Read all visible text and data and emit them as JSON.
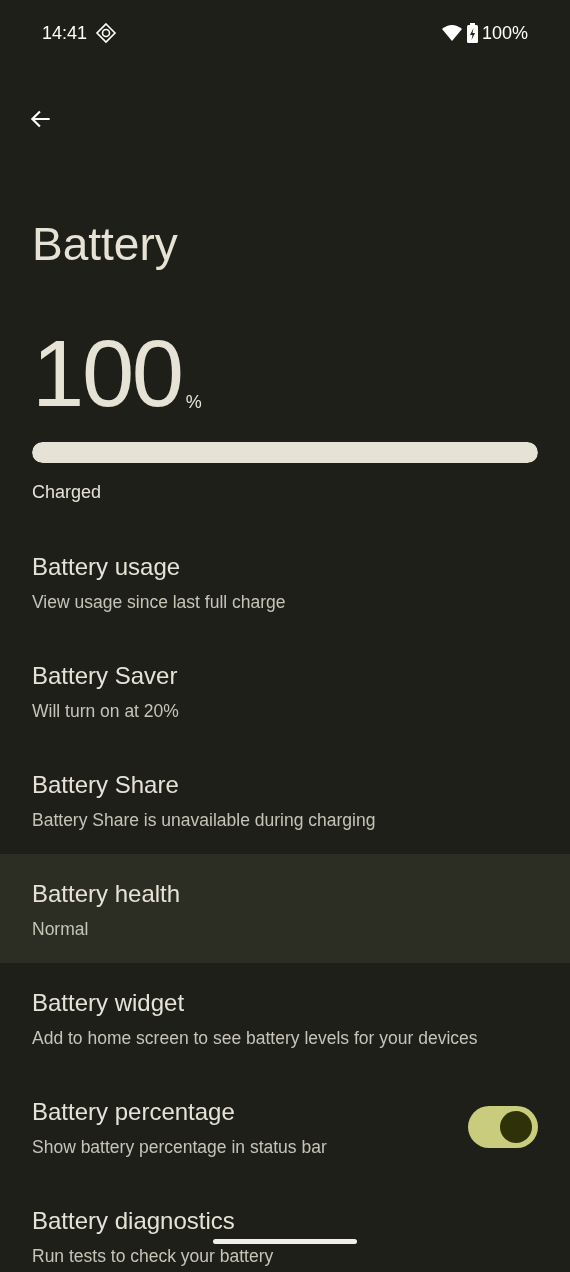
{
  "status_bar": {
    "time": "14:41",
    "battery": "100%"
  },
  "title": "Battery",
  "level_display": {
    "value": "100",
    "unit": "%",
    "level": 1.0,
    "status": "Charged"
  },
  "items": [
    {
      "kind": "link",
      "title": "Battery usage",
      "subtitle": "View usage since last full charge",
      "selected": false
    },
    {
      "kind": "link",
      "title": "Battery Saver",
      "subtitle": "Will turn on at 20%",
      "selected": false
    },
    {
      "kind": "link",
      "title": "Battery Share",
      "subtitle": "Battery Share is unavailable during charging",
      "selected": false
    },
    {
      "kind": "link",
      "title": "Battery health",
      "subtitle": "Normal",
      "selected": true
    },
    {
      "kind": "link",
      "title": "Battery widget",
      "subtitle": "Add to home screen to see battery levels for your devices",
      "selected": false
    },
    {
      "kind": "switch",
      "title": "Battery percentage",
      "subtitle": "Show battery percentage in status bar",
      "selected": false,
      "on": true
    },
    {
      "kind": "link",
      "title": "Battery diagnostics",
      "subtitle": "Run tests to check your battery",
      "selected": false
    }
  ]
}
